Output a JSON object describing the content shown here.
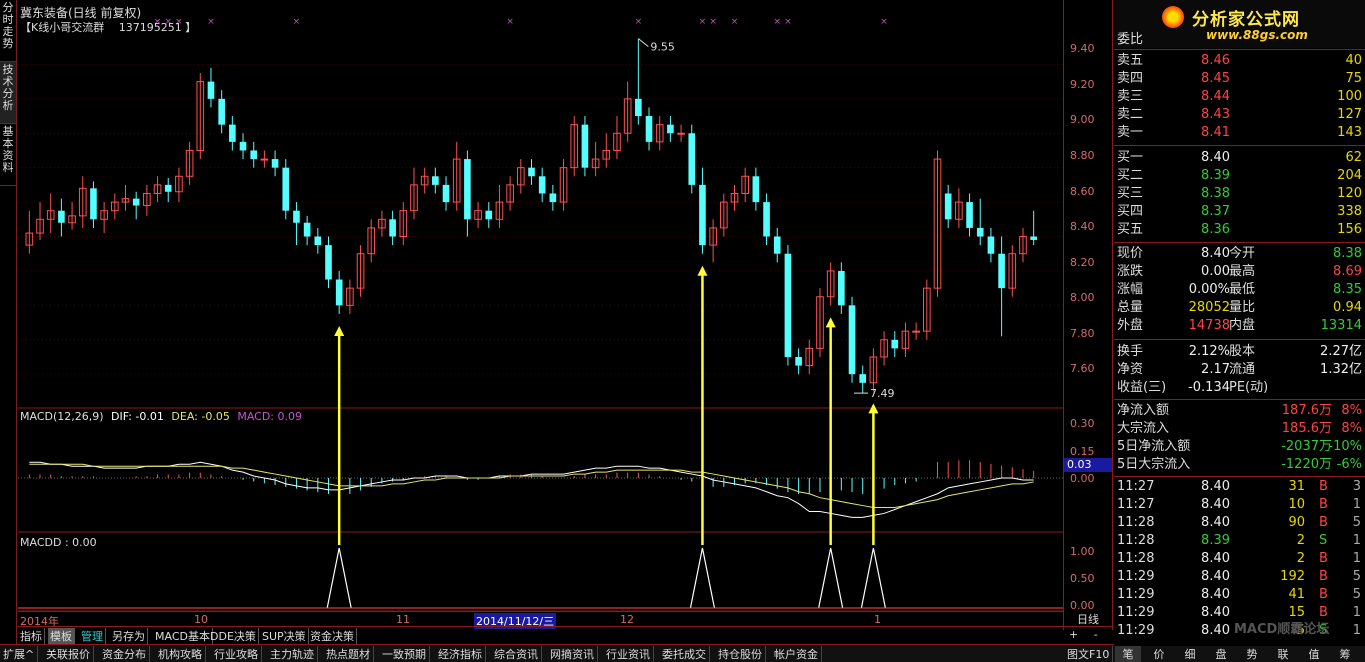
{
  "left_tabs": [
    {
      "label": "分时走势"
    },
    {
      "label": "技术分析"
    },
    {
      "label": "基本资料"
    }
  ],
  "header": {
    "title": "冀东装备(日线 前复权)",
    "subtitle": "【K线小哥交流群　 137195251 】"
  },
  "price_axis": {
    "ticks": [
      "9.40",
      "9.20",
      "9.00",
      "8.80",
      "8.60",
      "8.40",
      "8.20",
      "8.00",
      "7.80",
      "7.60"
    ]
  },
  "macd_axis": {
    "ticks": [
      "0.30",
      "0.15",
      "0.00"
    ],
    "current": "0.03"
  },
  "macdd_axis": {
    "ticks": [
      "1.00",
      "0.50",
      "0.00"
    ]
  },
  "annotations": {
    "high": "9.55",
    "low": "7.49"
  },
  "macd_label": {
    "name": "MACD(12,26,9)",
    "dif": "DIF: -0.01",
    "dea": "DEA: -0.05",
    "macd": "MACD: 0.09"
  },
  "macdd_label": "MACDD : 0.00",
  "x_axis": {
    "labels": [
      "2014年",
      "10",
      "11",
      "2014/11/12/三",
      "12",
      "1"
    ]
  },
  "unit_label": "日线",
  "chart_data": {
    "type": "candlestick",
    "ylim": [
      7.45,
      9.6
    ],
    "candles": [
      [
        8.35,
        8.42,
        8.3,
        8.55
      ],
      [
        8.42,
        8.5,
        8.38,
        8.6
      ],
      [
        8.5,
        8.55,
        8.42,
        8.65
      ],
      [
        8.55,
        8.48,
        8.4,
        8.62
      ],
      [
        8.48,
        8.52,
        8.44,
        8.6
      ],
      [
        8.52,
        8.68,
        8.45,
        8.75
      ],
      [
        8.68,
        8.5,
        8.45,
        8.72
      ],
      [
        8.5,
        8.55,
        8.42,
        8.6
      ],
      [
        8.55,
        8.6,
        8.5,
        8.65
      ],
      [
        8.6,
        8.62,
        8.55,
        8.7
      ],
      [
        8.62,
        8.58,
        8.5,
        8.66
      ],
      [
        8.58,
        8.65,
        8.52,
        8.7
      ],
      [
        8.65,
        8.7,
        8.6,
        8.75
      ],
      [
        8.7,
        8.66,
        8.6,
        8.74
      ],
      [
        8.66,
        8.75,
        8.6,
        8.8
      ],
      [
        8.75,
        8.9,
        8.7,
        8.95
      ],
      [
        8.9,
        9.3,
        8.85,
        9.35
      ],
      [
        9.3,
        9.2,
        9.15,
        9.38
      ],
      [
        9.2,
        9.05,
        9.0,
        9.25
      ],
      [
        9.05,
        8.95,
        8.9,
        9.1
      ],
      [
        8.95,
        8.9,
        8.85,
        9.0
      ],
      [
        8.9,
        8.85,
        8.8,
        8.95
      ],
      [
        8.85,
        8.85,
        8.8,
        8.9
      ],
      [
        8.85,
        8.8,
        8.75,
        8.9
      ],
      [
        8.8,
        8.55,
        8.5,
        8.85
      ],
      [
        8.55,
        8.48,
        8.35,
        8.6
      ],
      [
        8.48,
        8.4,
        8.35,
        8.52
      ],
      [
        8.4,
        8.35,
        8.3,
        8.45
      ],
      [
        8.35,
        8.15,
        8.1,
        8.4
      ],
      [
        8.15,
        8.0,
        7.95,
        8.2
      ],
      [
        8.0,
        8.1,
        7.95,
        8.15
      ],
      [
        8.1,
        8.3,
        8.05,
        8.35
      ],
      [
        8.3,
        8.45,
        8.25,
        8.5
      ],
      [
        8.45,
        8.5,
        8.4,
        8.55
      ],
      [
        8.5,
        8.4,
        8.35,
        8.55
      ],
      [
        8.4,
        8.55,
        8.35,
        8.6
      ],
      [
        8.55,
        8.7,
        8.5,
        8.8
      ],
      [
        8.7,
        8.75,
        8.65,
        8.8
      ],
      [
        8.75,
        8.7,
        8.65,
        8.8
      ],
      [
        8.7,
        8.6,
        8.55,
        8.75
      ],
      [
        8.6,
        8.85,
        8.55,
        8.95
      ],
      [
        8.85,
        8.5,
        8.4,
        8.9
      ],
      [
        8.5,
        8.55,
        8.45,
        8.6
      ],
      [
        8.55,
        8.5,
        8.45,
        8.6
      ],
      [
        8.5,
        8.6,
        8.45,
        8.7
      ],
      [
        8.6,
        8.7,
        8.55,
        8.75
      ],
      [
        8.7,
        8.8,
        8.65,
        8.85
      ],
      [
        8.8,
        8.75,
        8.7,
        8.85
      ],
      [
        8.75,
        8.65,
        8.6,
        8.8
      ],
      [
        8.65,
        8.6,
        8.55,
        8.7
      ],
      [
        8.6,
        8.8,
        8.55,
        8.85
      ],
      [
        8.8,
        9.05,
        8.75,
        9.1
      ],
      [
        9.05,
        8.8,
        8.75,
        9.1
      ],
      [
        8.8,
        8.85,
        8.75,
        8.95
      ],
      [
        8.85,
        8.9,
        8.8,
        9.0
      ],
      [
        8.9,
        9.0,
        8.85,
        9.1
      ],
      [
        9.0,
        9.2,
        8.95,
        9.3
      ],
      [
        9.2,
        9.1,
        9.05,
        9.55
      ],
      [
        9.1,
        8.95,
        8.9,
        9.15
      ],
      [
        8.95,
        9.05,
        8.9,
        9.1
      ],
      [
        9.05,
        9.0,
        8.95,
        9.1
      ],
      [
        9.0,
        9.0,
        8.95,
        9.05
      ],
      [
        9.0,
        8.7,
        8.65,
        9.05
      ],
      [
        8.7,
        8.35,
        8.3,
        8.8
      ],
      [
        8.35,
        8.45,
        8.25,
        8.5
      ],
      [
        8.45,
        8.6,
        8.4,
        8.65
      ],
      [
        8.6,
        8.65,
        8.55,
        8.7
      ],
      [
        8.65,
        8.75,
        8.6,
        8.8
      ],
      [
        8.75,
        8.6,
        8.55,
        8.8
      ],
      [
        8.6,
        8.4,
        8.35,
        8.65
      ],
      [
        8.4,
        8.3,
        8.25,
        8.45
      ],
      [
        8.3,
        7.7,
        7.65,
        8.35
      ],
      [
        7.7,
        7.65,
        7.6,
        7.75
      ],
      [
        7.65,
        7.75,
        7.6,
        7.8
      ],
      [
        7.75,
        8.05,
        7.7,
        8.1
      ],
      [
        8.05,
        8.2,
        8.0,
        8.25
      ],
      [
        8.2,
        8.0,
        7.95,
        8.25
      ],
      [
        8.0,
        7.6,
        7.55,
        8.05
      ],
      [
        7.6,
        7.55,
        7.49,
        7.65
      ],
      [
        7.55,
        7.7,
        7.5,
        7.75
      ],
      [
        7.7,
        7.8,
        7.65,
        7.85
      ],
      [
        7.8,
        7.75,
        7.7,
        7.85
      ],
      [
        7.75,
        7.85,
        7.7,
        7.9
      ],
      [
        7.85,
        7.85,
        7.8,
        7.9
      ],
      [
        7.85,
        8.1,
        7.8,
        8.15
      ],
      [
        8.1,
        8.85,
        8.05,
        8.9
      ],
      [
        8.65,
        8.5,
        8.45,
        8.7
      ],
      [
        8.5,
        8.6,
        8.45,
        8.68
      ],
      [
        8.6,
        8.45,
        8.4,
        8.65
      ],
      [
        8.45,
        8.4,
        8.35,
        8.62
      ],
      [
        8.4,
        8.3,
        8.25,
        8.45
      ],
      [
        8.3,
        8.1,
        7.82,
        8.4
      ],
      [
        8.1,
        8.3,
        8.05,
        8.35
      ],
      [
        8.3,
        8.4,
        8.25,
        8.45
      ],
      [
        8.4,
        8.38,
        8.35,
        8.55
      ]
    ],
    "macd_hist": [
      0.02,
      0.02,
      0.02,
      0.01,
      0.01,
      0.01,
      0.01,
      0.0,
      0.0,
      0.0,
      0.01,
      0.01,
      0.02,
      0.02,
      0.02,
      0.03,
      0.03,
      0.02,
      0.01,
      0.0,
      -0.01,
      -0.02,
      -0.03,
      -0.04,
      -0.05,
      -0.06,
      -0.07,
      -0.08,
      -0.09,
      -0.1,
      -0.09,
      -0.07,
      -0.05,
      -0.03,
      -0.02,
      -0.01,
      0.0,
      0.01,
      0.01,
      0.01,
      0.0,
      -0.01,
      -0.01,
      0.0,
      0.01,
      0.02,
      0.02,
      0.02,
      0.01,
      0.0,
      0.0,
      0.01,
      0.02,
      0.02,
      0.02,
      0.03,
      0.03,
      0.03,
      0.02,
      0.01,
      0.0,
      -0.01,
      -0.02,
      -0.04,
      -0.05,
      -0.05,
      -0.04,
      -0.03,
      -0.03,
      -0.04,
      -0.06,
      -0.08,
      -0.09,
      -0.09,
      -0.08,
      -0.07,
      -0.07,
      -0.08,
      -0.09,
      -0.08,
      -0.06,
      -0.04,
      -0.03,
      -0.02,
      0.0,
      0.09,
      0.09,
      0.1,
      0.1,
      0.09,
      0.08,
      0.07,
      0.06,
      0.05,
      0.04
    ],
    "dif": [
      0.08,
      0.08,
      0.07,
      0.07,
      0.06,
      0.06,
      0.06,
      0.05,
      0.05,
      0.05,
      0.05,
      0.06,
      0.06,
      0.06,
      0.07,
      0.07,
      0.08,
      0.07,
      0.06,
      0.04,
      0.03,
      0.01,
      0.0,
      -0.01,
      -0.03,
      -0.04,
      -0.05,
      -0.05,
      -0.06,
      -0.06,
      -0.05,
      -0.04,
      -0.03,
      -0.02,
      -0.01,
      -0.01,
      0.0,
      0.0,
      0.01,
      0.01,
      0.01,
      0.0,
      0.0,
      0.0,
      0.01,
      0.01,
      0.01,
      0.02,
      0.02,
      0.02,
      0.02,
      0.03,
      0.04,
      0.05,
      0.05,
      0.06,
      0.06,
      0.06,
      0.05,
      0.05,
      0.04,
      0.03,
      0.02,
      0.01,
      -0.01,
      -0.02,
      -0.03,
      -0.04,
      -0.05,
      -0.07,
      -0.09,
      -0.1,
      -0.13,
      -0.17,
      -0.17,
      -0.18,
      -0.19,
      -0.2,
      -0.2,
      -0.19,
      -0.18,
      -0.16,
      -0.14,
      -0.12,
      -0.1,
      -0.08,
      -0.05,
      -0.04,
      -0.03,
      -0.02,
      -0.01,
      -0.0,
      0.0,
      -0.01,
      -0.01
    ],
    "dea": [
      0.07,
      0.07,
      0.07,
      0.07,
      0.07,
      0.07,
      0.06,
      0.06,
      0.06,
      0.06,
      0.06,
      0.06,
      0.06,
      0.06,
      0.06,
      0.06,
      0.06,
      0.06,
      0.06,
      0.05,
      0.05,
      0.04,
      0.03,
      0.02,
      0.01,
      0.0,
      -0.01,
      -0.02,
      -0.03,
      -0.04,
      -0.04,
      -0.04,
      -0.04,
      -0.04,
      -0.03,
      -0.03,
      -0.02,
      -0.01,
      -0.01,
      0.0,
      0.0,
      0.0,
      0.0,
      0.0,
      0.0,
      0.01,
      0.01,
      0.01,
      0.01,
      0.01,
      0.01,
      0.02,
      0.02,
      0.03,
      0.03,
      0.04,
      0.04,
      0.04,
      0.04,
      0.04,
      0.04,
      0.04,
      0.03,
      0.03,
      0.02,
      0.01,
      0.0,
      -0.01,
      -0.02,
      -0.03,
      -0.04,
      -0.05,
      -0.07,
      -0.08,
      -0.1,
      -0.11,
      -0.12,
      -0.13,
      -0.14,
      -0.15,
      -0.15,
      -0.15,
      -0.14,
      -0.13,
      -0.12,
      -0.11,
      -0.09,
      -0.08,
      -0.07,
      -0.06,
      -0.05,
      -0.04,
      -0.03,
      -0.03,
      -0.02
    ],
    "arrow_candles": [
      29,
      63,
      75,
      79
    ],
    "macdd_spikes": [
      29,
      63,
      75,
      79
    ]
  },
  "quote": {
    "weibi": "委比",
    "sells": [
      {
        "label": "卖五",
        "price": "8.46",
        "vol": "40"
      },
      {
        "label": "卖四",
        "price": "8.45",
        "vol": "75"
      },
      {
        "label": "卖三",
        "price": "8.44",
        "vol": "100"
      },
      {
        "label": "卖二",
        "price": "8.43",
        "vol": "127"
      },
      {
        "label": "卖一",
        "price": "8.41",
        "vol": "143"
      }
    ],
    "buys": [
      {
        "label": "买一",
        "price": "8.40",
        "vol": "62",
        "color": "white"
      },
      {
        "label": "买二",
        "price": "8.39",
        "vol": "204",
        "color": "green"
      },
      {
        "label": "买三",
        "price": "8.38",
        "vol": "120",
        "color": "green"
      },
      {
        "label": "买四",
        "price": "8.37",
        "vol": "338",
        "color": "green"
      },
      {
        "label": "买五",
        "price": "8.36",
        "vol": "156",
        "color": "green"
      }
    ],
    "stats": [
      {
        "l1": "现价",
        "v1": "8.40",
        "c1": "white",
        "l2": "今开",
        "v2": "8.38",
        "c2": "green"
      },
      {
        "l1": "涨跌",
        "v1": "0.00",
        "c1": "white",
        "l2": "最高",
        "v2": "8.69",
        "c2": "red"
      },
      {
        "l1": "涨幅",
        "v1": "0.00%",
        "c1": "white",
        "l2": "最低",
        "v2": "8.35",
        "c2": "green"
      },
      {
        "l1": "总量",
        "v1": "28052",
        "c1": "yellow",
        "l2": "量比",
        "v2": "0.94",
        "c2": "yellow"
      },
      {
        "l1": "外盘",
        "v1": "14738",
        "c1": "red",
        "l2": "内盘",
        "v2": "13314",
        "c2": "green"
      }
    ],
    "stats2": [
      {
        "l1": "换手",
        "v1": "2.12%",
        "l2": "股本",
        "v2": "2.27亿"
      },
      {
        "l1": "净资",
        "v1": "2.17",
        "l2": "流通",
        "v2": "1.32亿"
      },
      {
        "l1": "收益(三)",
        "v1": "-0.134",
        "l2": "PE(动)",
        "v2": ""
      }
    ],
    "flows": [
      {
        "label": "净流入额",
        "value": "187.6万",
        "pct": "8%",
        "color": "red"
      },
      {
        "label": "大宗流入",
        "value": "185.6万",
        "pct": "8%",
        "color": "red"
      },
      {
        "label": "5日净流入额",
        "value": "-2037万",
        "pct": "-10%",
        "color": "green"
      },
      {
        "label": "5日大宗流入",
        "value": "-1220万",
        "pct": "-6%",
        "color": "green"
      }
    ],
    "ticks": [
      {
        "t": "11:27",
        "p": "8.40",
        "pc": "white",
        "v": "31",
        "bs": "B",
        "n": "3"
      },
      {
        "t": "11:27",
        "p": "8.40",
        "pc": "white",
        "v": "10",
        "bs": "B",
        "n": "1"
      },
      {
        "t": "11:28",
        "p": "8.40",
        "pc": "white",
        "v": "90",
        "bs": "B",
        "n": "5"
      },
      {
        "t": "11:28",
        "p": "8.39",
        "pc": "green",
        "v": "2",
        "bs": "S",
        "n": "1"
      },
      {
        "t": "11:28",
        "p": "8.40",
        "pc": "white",
        "v": "2",
        "bs": "B",
        "n": "1"
      },
      {
        "t": "11:29",
        "p": "8.40",
        "pc": "white",
        "v": "192",
        "bs": "B",
        "n": "5"
      },
      {
        "t": "11:29",
        "p": "8.40",
        "pc": "white",
        "v": "41",
        "bs": "B",
        "n": "5"
      },
      {
        "t": "11:29",
        "p": "8.40",
        "pc": "white",
        "v": "15",
        "bs": "B",
        "n": "1"
      },
      {
        "t": "11:29",
        "p": "8.40",
        "pc": "white",
        "v": "5",
        "bs": "S",
        "n": "1"
      }
    ]
  },
  "logo": {
    "text": "分析家公式网",
    "url": "www.88gs.com",
    "watermark": "MACD顺霸论坛"
  },
  "toolbar1": [
    "指标",
    "模板",
    "管理",
    "另存为",
    "MACD基本",
    "DDE决策",
    "SUP决策",
    "资金决策"
  ],
  "toolbar2": [
    "扩展^",
    "关联报价",
    "资金分布",
    "机构攻略",
    "行业攻略",
    "主力轨迹",
    "热点题材",
    "一致预期",
    "经济指标",
    "综合资讯",
    "网摘资讯",
    "行业资讯",
    "委托成交",
    "持仓股份",
    "帐户资金"
  ],
  "toolbar2_right": "图文F10",
  "right_tabs": [
    "笔",
    "价",
    "细",
    "盘",
    "势",
    "联",
    "值",
    "筹"
  ],
  "zoom": {
    "plus": "+",
    "minus": "-"
  }
}
